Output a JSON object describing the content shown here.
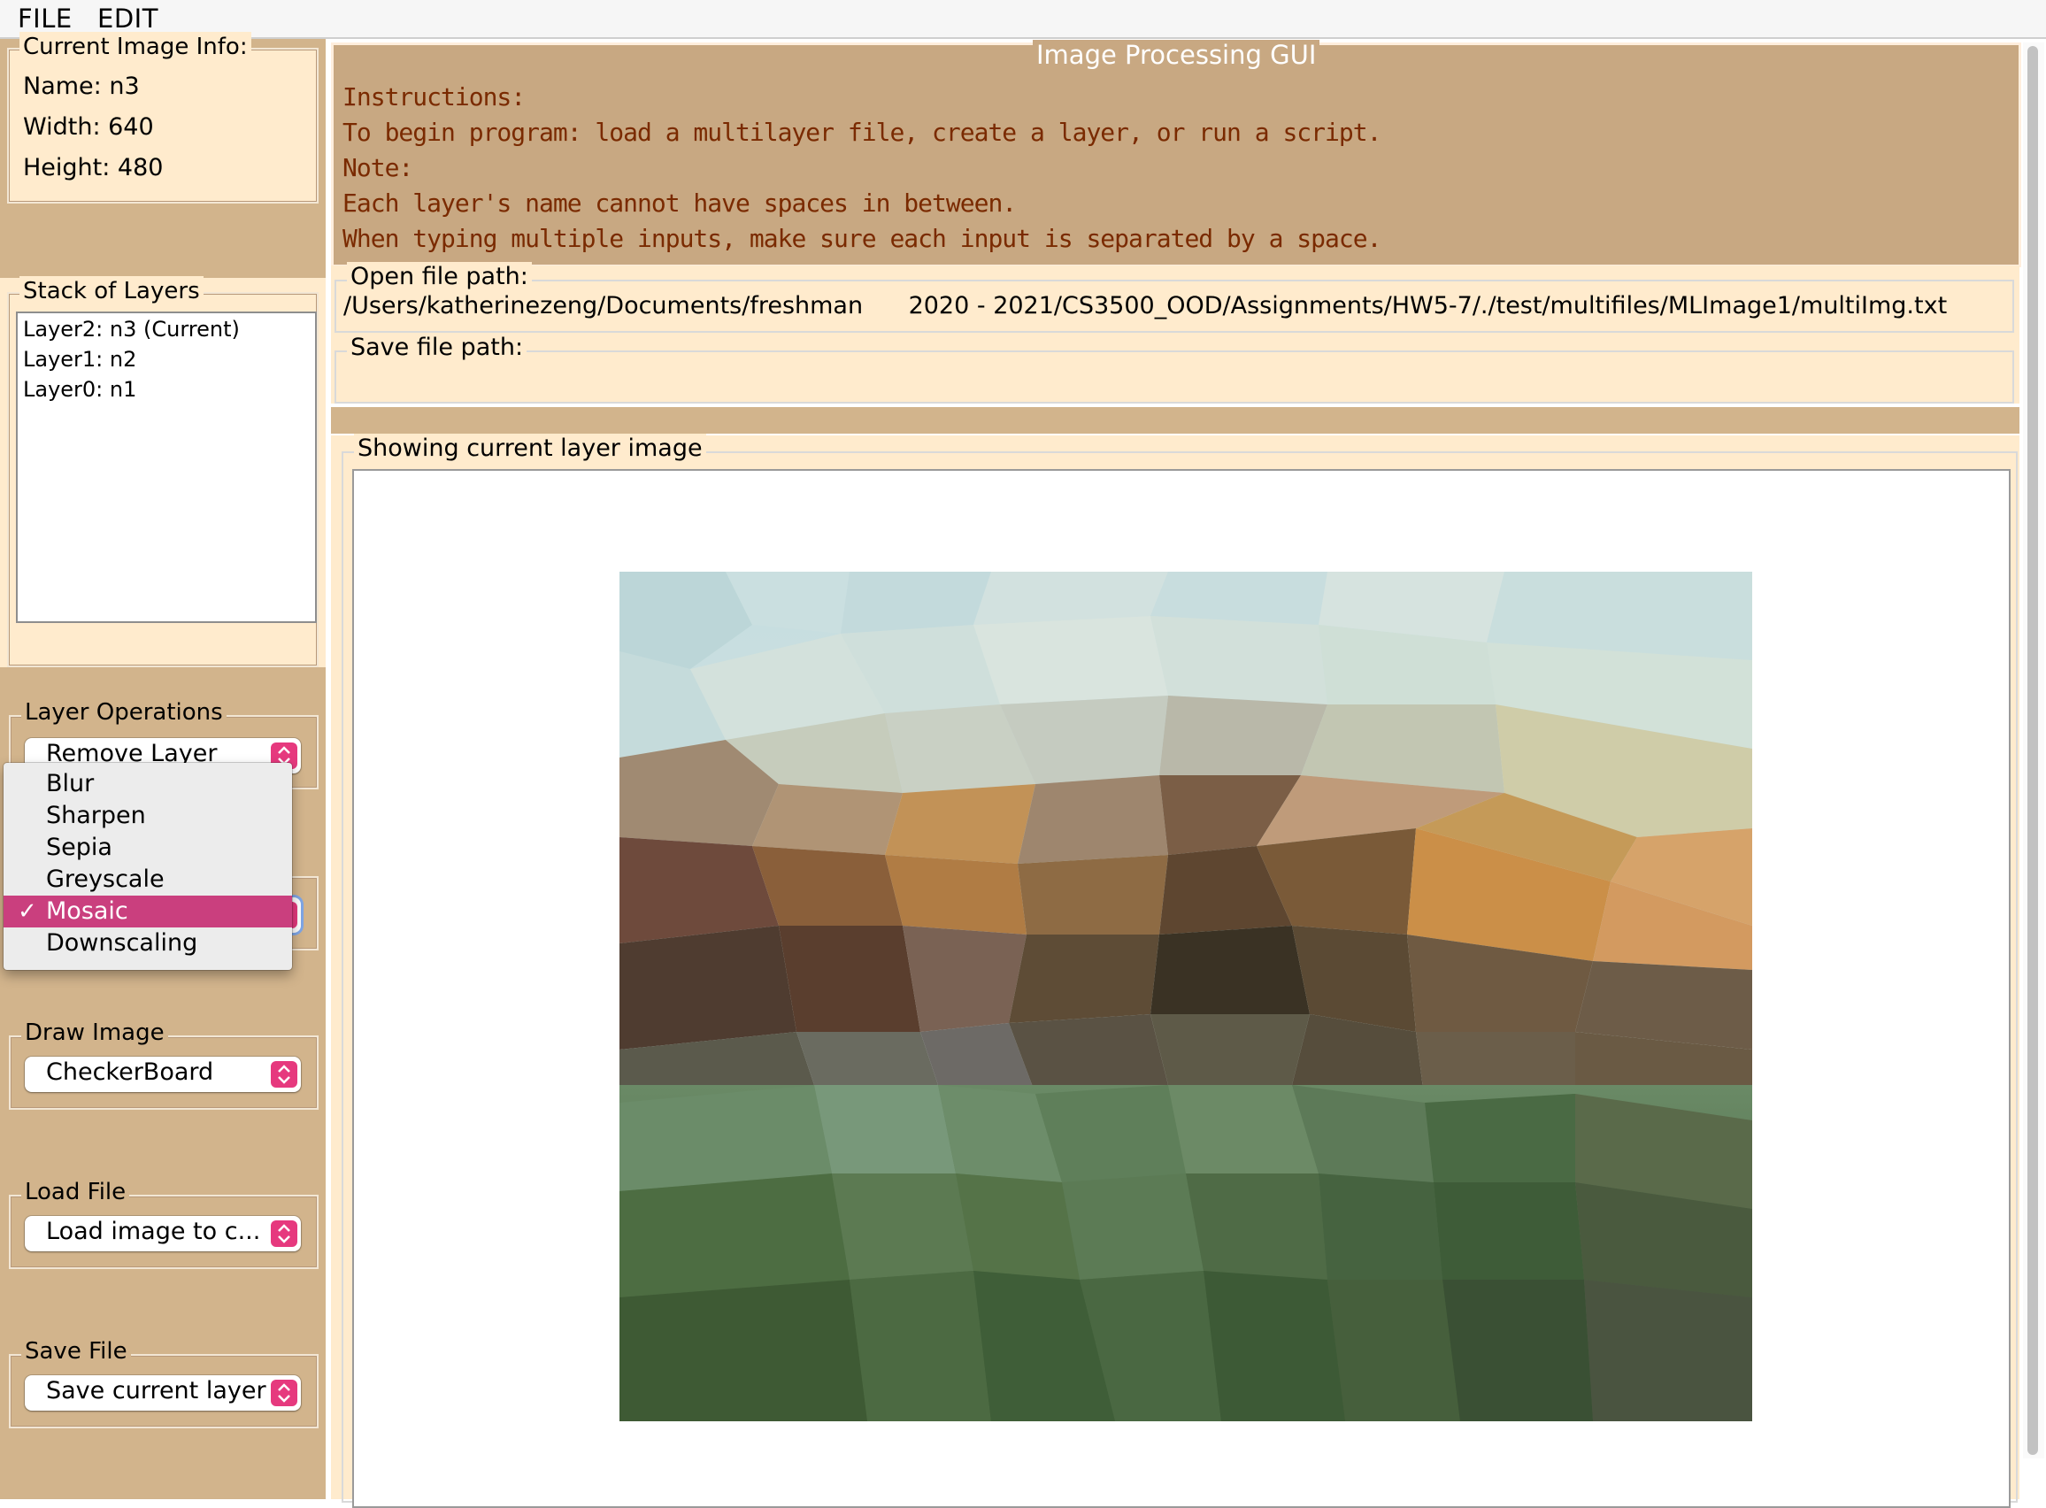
{
  "menubar": {
    "file_label": "FILE",
    "edit_label": "EDIT"
  },
  "image_info": {
    "title": "Current Image Info:",
    "name": "Name: n3",
    "width": "Width: 640",
    "height": "Height: 480"
  },
  "layers": {
    "title": "Stack of Layers",
    "items": [
      "Layer2: n3 (Current)",
      "Layer1: n2",
      "Layer0: n1"
    ]
  },
  "layer_ops": {
    "title": "Layer Operations",
    "selected": "Remove Layer"
  },
  "image_enhancement": {
    "options": [
      "Blur",
      "Sharpen",
      "Sepia",
      "Greyscale",
      "Mosaic",
      "Downscaling"
    ],
    "selected": "Mosaic",
    "check_mark": "✓"
  },
  "draw_image": {
    "title": "Draw Image",
    "selected": "CheckerBoard"
  },
  "load_file": {
    "title": "Load File",
    "selected": "Load image to c..."
  },
  "save_file": {
    "title": "Save File",
    "selected": "Save current layer"
  },
  "instructions": {
    "title": "Image Processing GUI",
    "lines": [
      "Instructions:",
      "To begin program: load a multilayer file, create a layer, or run a script.",
      "Note:",
      "Each layer's name cannot have spaces in between.",
      "When typing multiple inputs, make sure each input is separated by a space."
    ]
  },
  "open_path": {
    "title": "Open file path:",
    "value": "/Users/katherinezeng/Documents/freshman      2020 - 2021/CS3500_OOD/Assignments/HW5-7/./test/multifiles/MLImage1/multiImg.txt"
  },
  "save_path": {
    "title": "Save file path:",
    "value": ""
  },
  "image_view": {
    "title": "Showing current layer image"
  },
  "colors": {
    "panel_tan": "#d2b48c",
    "panel_light": "#ffebcd",
    "instructions_bg": "#c8a882",
    "instruction_text": "#7a2a00",
    "selection_pink": "#ca3f7e",
    "combo_accent": "#e6397e"
  }
}
